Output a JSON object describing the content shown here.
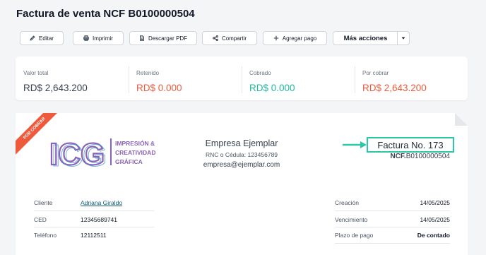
{
  "page": {
    "title": "Factura de venta NCF B0100000504"
  },
  "toolbar": {
    "edit": "Editar",
    "print": "Imprimir",
    "download": "Descargar PDF",
    "share": "Compartir",
    "add_payment": "Agregar pago",
    "more_actions": "Más acciones"
  },
  "summary": [
    {
      "label": "Valor total",
      "value": "RD$ 2,643.200",
      "color": "#374151"
    },
    {
      "label": "Retenido",
      "value": "RD$ 0.000",
      "color": "#ef5a3c"
    },
    {
      "label": "Cobrado",
      "value": "RD$ 0.000",
      "color": "#1fb8a0"
    },
    {
      "label": "Por cobrar",
      "value": "RD$ 2,643.200",
      "color": "#ef5a3c"
    }
  ],
  "invoice": {
    "status_ribbon": "POR COBRAR",
    "logo": {
      "letters": "ICG",
      "line1": "IMPRESIÓN &",
      "line2": "CREATIVIDAD",
      "line3": "GRÁFICA"
    },
    "company": {
      "name": "Empresa Ejemplar",
      "rnc": "RNC o Cédula: 123456789",
      "email": "empresa@ejemplar.com"
    },
    "number": "Factura No. 173",
    "ncf_prefix": "NCF.",
    "ncf_value": "B0100000504",
    "client_rows": [
      {
        "label": "Cliente",
        "value": "Adriana Giraldo"
      },
      {
        "label": "CED",
        "value": "12345689741"
      },
      {
        "label": "Teléfono",
        "value": "12112511"
      }
    ],
    "date_rows": [
      {
        "label": "Creación",
        "value": "14/05/2025"
      },
      {
        "label": "Vencimiento",
        "value": "14/05/2025"
      },
      {
        "label": "Plazo de pago",
        "value": "De contado"
      }
    ]
  },
  "colors": {
    "accent_red": "#ef5a3c",
    "accent_teal": "#1fb8a0",
    "highlight_box": "#2cc6a9",
    "logo_purple": "#8a63b8",
    "logo_blue": "#3b8fd6"
  }
}
